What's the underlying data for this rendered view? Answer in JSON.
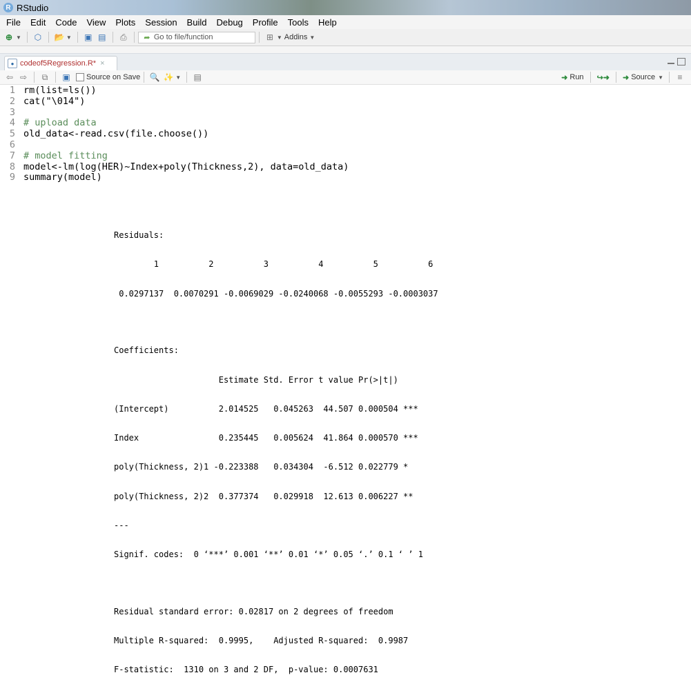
{
  "window": {
    "title": "RStudio",
    "icon_letter": "R"
  },
  "menu": [
    "File",
    "Edit",
    "Code",
    "View",
    "Plots",
    "Session",
    "Build",
    "Debug",
    "Profile",
    "Tools",
    "Help"
  ],
  "toolbar": {
    "goto_placeholder": "Go to file/function",
    "addins_label": "Addins"
  },
  "editor": {
    "tab_label": "codeof5Regression.R*",
    "source_on_save_label": "Source on Save",
    "run_label": "Run",
    "source_label": "Source",
    "lines": [
      {
        "num": "1",
        "text": "rm(list=ls())",
        "comment": false
      },
      {
        "num": "2",
        "text": "cat(\"\\014\")",
        "comment": false
      },
      {
        "num": "3",
        "text": "",
        "comment": false
      },
      {
        "num": "4",
        "text": "# upload data",
        "comment": true
      },
      {
        "num": "5",
        "text": "old_data<-read.csv(file.choose())",
        "comment": false
      },
      {
        "num": "6",
        "text": "",
        "comment": false
      },
      {
        "num": "7",
        "text": "# model fitting",
        "comment": true
      },
      {
        "num": "8",
        "text": "model<-lm(log(HER)~Index+poly(Thickness,2), data=old_data)",
        "comment": false
      },
      {
        "num": "9",
        "text": "summary(model)",
        "comment": false
      }
    ]
  },
  "console": {
    "residuals_header": "Residuals:",
    "residuals_index_row": "        1          2          3          4          5          6",
    "residuals_value_row": " 0.0297137  0.0070291 -0.0069029 -0.0240068 -0.0055293 -0.0003037",
    "coefficients_header": "Coefficients:",
    "coef_table_header": "                     Estimate Std. Error t value Pr(>|t|)    ",
    "coef_rows": [
      "(Intercept)          2.014525   0.045263  44.507 0.000504 ***",
      "Index                0.235445   0.005624  41.864 0.000570 ***",
      "poly(Thickness, 2)1 -0.223388   0.034304  -6.512 0.022779 *  ",
      "poly(Thickness, 2)2  0.377374   0.029918  12.613 0.006227 ** "
    ],
    "divider": "---",
    "signif_codes": "Signif. codes:  0 ‘***’ 0.001 ‘**’ 0.01 ‘*’ 0.05 ‘.’ 0.1 ‘ ’ 1",
    "rse_line": "Residual standard error: 0.02817 on 2 degrees of freedom",
    "r2_line": "Multiple R-squared:  0.9995,\tAdjusted R-squared:  0.9987 ",
    "f_line": "F-statistic:  1310 on 3 and 2 DF,  p-value: 0.0007631"
  }
}
